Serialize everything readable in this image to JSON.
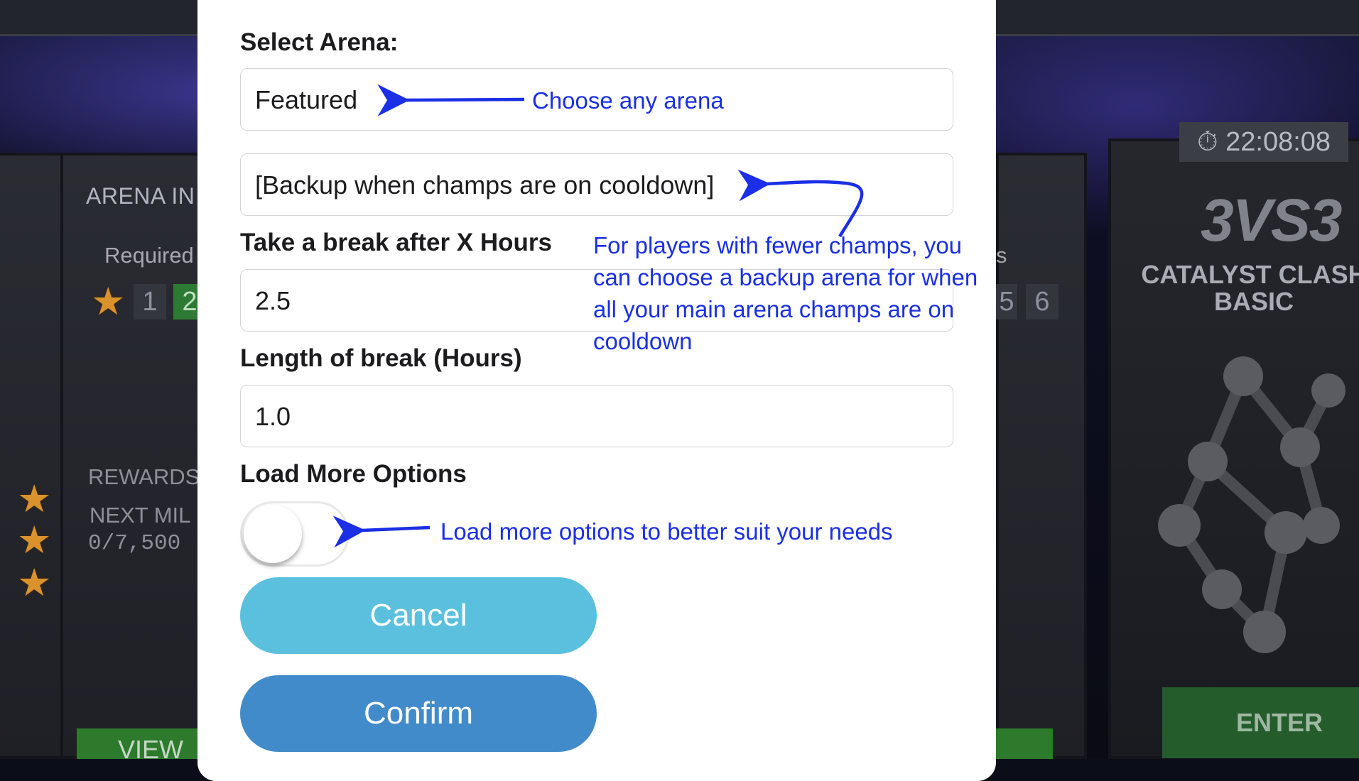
{
  "background": {
    "left_panel": {
      "title": "ARENA IN",
      "required_label": "Required",
      "tier_numbers": [
        "1",
        "2"
      ],
      "rewards_label": "REWARDS",
      "milestone_label": "NEXT MIL",
      "milestone_progress": "0/7,500",
      "view_button": "VIEW"
    },
    "mid_panel": {
      "label_fragment": "s",
      "tier_numbers": [
        "5",
        "6"
      ]
    },
    "right_panel": {
      "timer": "22:08:08",
      "mode": "3VS3",
      "title_line1": "CATALYST CLASH",
      "title_line2": "BASIC",
      "enter_button": "ENTER"
    }
  },
  "modal": {
    "select_arena_label": "Select Arena:",
    "arena_select_value": "Featured",
    "backup_arena_value": "[Backup when champs are on cooldown]",
    "break_after_label": "Take a break after X Hours",
    "break_after_value": "2.5",
    "break_length_label": "Length of break (Hours)",
    "break_length_value": "1.0",
    "load_more_label": "Load More Options",
    "load_more_toggle_on": false,
    "cancel_label": "Cancel",
    "confirm_label": "Confirm"
  },
  "annotations": {
    "arena_note": "Choose any arena",
    "backup_note_lines": [
      "For players with fewer champs, you",
      "can choose a backup arena for when",
      "all your main arena champs are on",
      "cooldown"
    ],
    "load_more_note": "Load more options to better suit your needs",
    "annotation_color": "#1a2fe6"
  },
  "colors": {
    "cancel_button": "#5bc0de",
    "confirm_button": "#428bca"
  }
}
